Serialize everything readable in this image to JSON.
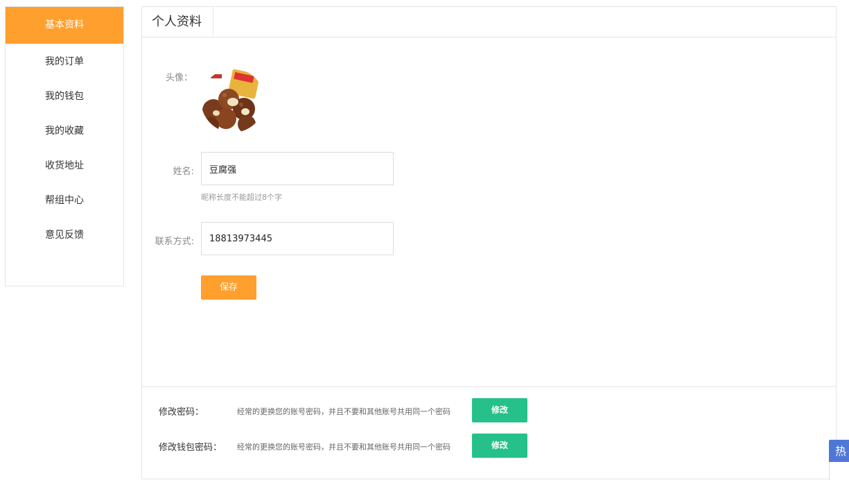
{
  "sidebar": {
    "items": [
      {
        "label": "基本资料",
        "active": true
      },
      {
        "label": "我的订单"
      },
      {
        "label": "我的钱包"
      },
      {
        "label": "我的收藏"
      },
      {
        "label": "收货地址"
      },
      {
        "label": "帮组中心"
      },
      {
        "label": "意见反馈"
      }
    ]
  },
  "panel": {
    "tab_title": "个人资料",
    "avatar_label": "头像：",
    "name_label": "姓名:",
    "name_value": "豆腐强",
    "name_hint": "昵称长度不能超过8个字",
    "contact_label": "联系方式:",
    "contact_value": "18813973445",
    "save_label": "保存"
  },
  "security": {
    "password": {
      "label": "修改密码：",
      "desc": "经常的更换您的账号密码，并且不要和其他账号共用同一个密码",
      "button": "修改"
    },
    "wallet_password": {
      "label": "修改钱包密码：",
      "desc": "经常的更换您的账号密码，并且不要和其他账号共用同一个密码",
      "button": "修改"
    }
  },
  "hot_widget": {
    "label": "热"
  },
  "colors": {
    "accent": "#ff9f2d",
    "green": "#26c18a",
    "border": "#e5e5e5",
    "widget": "#4f77d8"
  }
}
